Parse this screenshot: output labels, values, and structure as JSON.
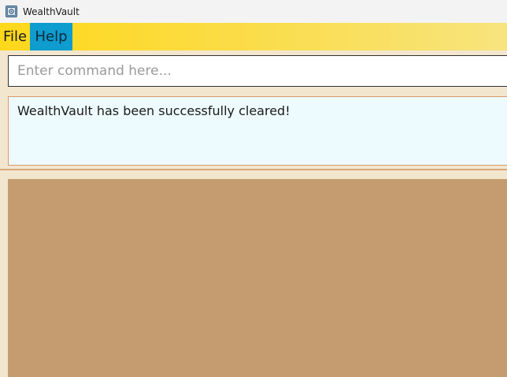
{
  "window": {
    "title": "WealthVault",
    "icon": "app-vault-icon"
  },
  "menu": {
    "items": [
      {
        "label": "File"
      },
      {
        "label": "Help"
      }
    ]
  },
  "command": {
    "value": "",
    "placeholder": "Enter command here..."
  },
  "result": {
    "message": "WealthVault has been successfully cleared!"
  },
  "colors": {
    "menu_gradient_start": "#fed81a",
    "menu_gradient_end": "#f7e47d",
    "help_highlight": "#0f9ccf",
    "result_bg": "#eefbfe",
    "panel_bg": "#c49c70",
    "window_bg": "#f3e6cf"
  }
}
